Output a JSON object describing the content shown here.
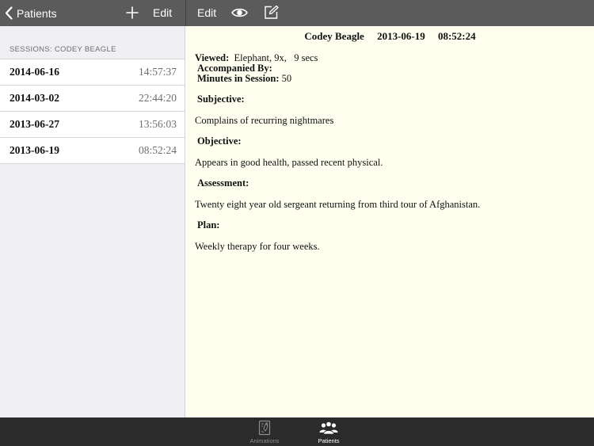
{
  "nav": {
    "back_label": "Patients",
    "left_edit_label": "Edit",
    "right_edit_label": "Edit"
  },
  "sidebar": {
    "section_header": "SESSIONS:  CODEY BEAGLE",
    "sessions": [
      {
        "date": "2014-06-16",
        "time": "14:57:37"
      },
      {
        "date": "2014-03-02",
        "time": "22:44:20"
      },
      {
        "date": "2013-06-27",
        "time": "13:56:03"
      },
      {
        "date": "2013-06-19",
        "time": "08:52:24"
      }
    ]
  },
  "note": {
    "header": "Codey Beagle     2013-06-19     08:52:24",
    "viewed_label": "Viewed:",
    "viewed_value": "  Elephant, 9x,   9 secs",
    "accompanied_label": "Accompanied By:",
    "accompanied_value": "",
    "minutes_label": "Minutes in Session:",
    "minutes_value": " 50",
    "sections": [
      {
        "title": "Subjective:",
        "text": "Complains of recurring nightmares"
      },
      {
        "title": "Objective:",
        "text": "Appears in good health, passed recent physical."
      },
      {
        "title": "Assessment:",
        "text": "Twenty eight year old sergeant returning from third tour of Afghanistan."
      },
      {
        "title": "Plan:",
        "text": "Weekly therapy for four weeks."
      }
    ]
  },
  "tabs": [
    {
      "label": "Animations",
      "icon": "animations-icon",
      "selected": false
    },
    {
      "label": "Patients",
      "icon": "patients-icon",
      "selected": true
    }
  ],
  "colors": {
    "nav_bar": "#5b5b5b",
    "sidebar_bg": "#efeff4",
    "note_bg": "#fffff0",
    "tab_bar": "#2b2b2b"
  }
}
